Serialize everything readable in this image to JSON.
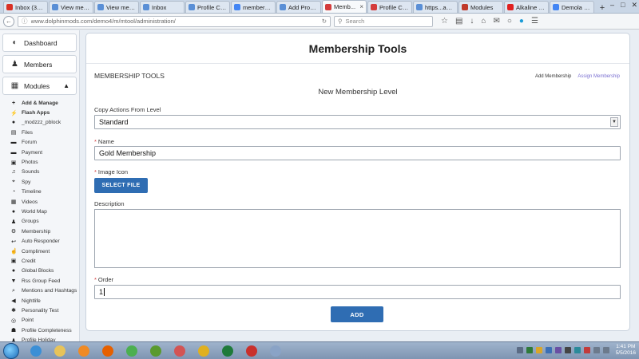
{
  "browser": {
    "tabs": [
      {
        "title": "Inbox (38...",
        "color": "#d93025",
        "active": false
      },
      {
        "title": "View mes...",
        "color": "#5a8fd6",
        "active": false
      },
      {
        "title": "View mes...",
        "color": "#5a8fd6",
        "active": false
      },
      {
        "title": "Inbox",
        "color": "#5a8fd6",
        "active": false
      },
      {
        "title": "Profile Co...",
        "color": "#5a8fd6",
        "active": false
      },
      {
        "title": "members...",
        "color": "#4285f4",
        "active": false
      },
      {
        "title": "Add Prod...",
        "color": "#5a8fd6",
        "active": false
      },
      {
        "title": "Memb...",
        "color": "#d43c3c",
        "active": true
      },
      {
        "title": "Profile Co...",
        "color": "#d43c3c",
        "active": false
      },
      {
        "title": "https...acker",
        "color": "#5a8fd6",
        "active": false
      },
      {
        "title": "Modules",
        "color": "#c0392b",
        "active": false
      },
      {
        "title": "Alkaline - ...",
        "color": "#e02020",
        "active": false
      },
      {
        "title": "Demola C...",
        "color": "#4285f4",
        "active": false
      }
    ],
    "url": "www.dolphinmods.com/demo4/m/mtool/administration/",
    "search_placeholder": "Search"
  },
  "sidebar": {
    "main_items": [
      {
        "label": "Dashboard",
        "icon": "dashboard-icon"
      },
      {
        "label": "Members",
        "icon": "members-icon"
      },
      {
        "label": "Modules",
        "icon": "modules-icon"
      }
    ],
    "sub_items": [
      {
        "label": "Add & Manage",
        "icon": "plus-icon",
        "bold": true
      },
      {
        "label": "Flash Apps",
        "icon": "bolt-icon",
        "bold": true
      },
      {
        "label": "_modzzz_pblock",
        "icon": "globe-icon",
        "bold": false
      },
      {
        "label": "Files",
        "icon": "file-icon",
        "bold": false
      },
      {
        "label": "Forum",
        "icon": "comments-icon",
        "bold": false
      },
      {
        "label": "Payment",
        "icon": "payment-icon",
        "bold": false
      },
      {
        "label": "Photos",
        "icon": "photo-icon",
        "bold": false
      },
      {
        "label": "Sounds",
        "icon": "music-icon",
        "bold": false
      },
      {
        "label": "Spy",
        "icon": "crosshair-icon",
        "bold": false
      },
      {
        "label": "Timeline",
        "icon": "clock-icon",
        "bold": false
      },
      {
        "label": "Videos",
        "icon": "film-icon",
        "bold": false
      },
      {
        "label": "World Map",
        "icon": "map-marker-icon",
        "bold": false
      },
      {
        "label": "Groups",
        "icon": "group-icon",
        "bold": false
      },
      {
        "label": "Membership",
        "icon": "gear-icon",
        "bold": false
      },
      {
        "label": "Auto Responder",
        "icon": "reply-icon",
        "bold": false
      },
      {
        "label": "Compliment",
        "icon": "thumbs-up-icon",
        "bold": false
      },
      {
        "label": "Credit",
        "icon": "credit-icon",
        "bold": false
      },
      {
        "label": "Global Blocks",
        "icon": "globe-icon",
        "bold": false
      },
      {
        "label": "Rss Group Feed",
        "icon": "filter-icon",
        "bold": false
      },
      {
        "label": "Mentions and Hashtags",
        "icon": "search-icon",
        "bold": false
      },
      {
        "label": "Nightlife",
        "icon": "bullhorn-icon",
        "bold": false
      },
      {
        "label": "Personality Test",
        "icon": "asterisk-icon",
        "bold": false
      },
      {
        "label": "Point",
        "icon": "target-icon",
        "bold": false
      },
      {
        "label": "Profile Completeness",
        "icon": "trophy-icon",
        "bold": false
      },
      {
        "label": "Profile Holiday",
        "icon": "user-icon",
        "bold": false
      }
    ]
  },
  "main": {
    "title": "Membership Tools",
    "tools_header": "MEMBERSHIP TOOLS",
    "links": {
      "add": "Add Membership",
      "assign": "Assign Membership"
    },
    "form_title": "New Membership Level",
    "copy_label": "Copy Actions From Level",
    "copy_value": "Standard",
    "name_label": "Name",
    "name_value": "Gold Membership",
    "image_label": "Image Icon",
    "select_file": "SELECT FILE",
    "description_label": "Description",
    "description_value": "",
    "order_label": "Order",
    "order_value": "1",
    "required_mark": "*",
    "add_button": "ADD"
  },
  "taskbar": {
    "time": "1:41 PM",
    "date": "5/5/2016",
    "apps": [
      {
        "name": "ie-icon",
        "color": "#3b8fd6"
      },
      {
        "name": "explorer-icon",
        "color": "#e7c35a"
      },
      {
        "name": "media-player-icon",
        "color": "#f08a24"
      },
      {
        "name": "firefox-icon",
        "color": "#e66000"
      },
      {
        "name": "chrome-icon",
        "color": "#4caf50"
      },
      {
        "name": "frog-icon",
        "color": "#5a9a2e"
      },
      {
        "name": "paint-icon",
        "color": "#d35454"
      },
      {
        "name": "ue-icon",
        "color": "#e0b020"
      },
      {
        "name": "excel-icon",
        "color": "#1f7a3a"
      },
      {
        "name": "filezilla-icon",
        "color": "#c9302c"
      },
      {
        "name": "tools-icon",
        "color": "#8aa3c6"
      }
    ]
  }
}
